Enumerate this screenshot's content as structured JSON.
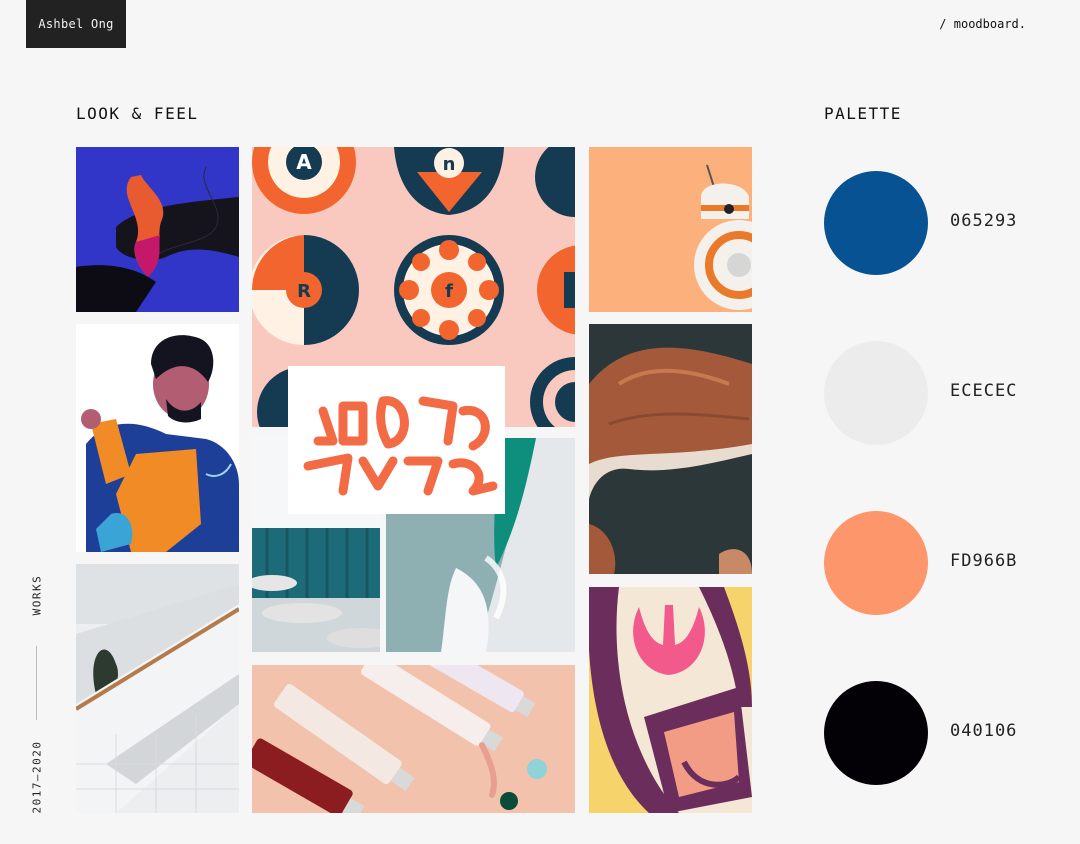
{
  "header": {
    "brand": "Ashbel Ong",
    "breadcrumb": "/ moodboard."
  },
  "sections": {
    "look_and_feel": "LOOK & FEEL",
    "palette": "PALETTE"
  },
  "sidebar": {
    "works_label": "WORKS",
    "years_label": "2017–2020"
  },
  "moodboard": {
    "tiles": [
      {
        "name": "hand-ribbon-image"
      },
      {
        "name": "character-portrait-image"
      },
      {
        "name": "staircase-image"
      },
      {
        "name": "letter-pattern-image",
        "letters": [
          "A",
          "n",
          "R",
          "f"
        ]
      },
      {
        "name": "logo-lettering-card"
      },
      {
        "name": "cafe-seating-image"
      },
      {
        "name": "ocean-aerial-image"
      },
      {
        "name": "paint-tubes-image"
      },
      {
        "name": "droid-image"
      },
      {
        "name": "canyon-aerial-image"
      },
      {
        "name": "rebel-emblem-image"
      }
    ]
  },
  "palette": {
    "swatches": [
      {
        "hex": "065293",
        "color": "#065293"
      },
      {
        "hex": "ECECEC",
        "color": "#ECECEC"
      },
      {
        "hex": "FD966B",
        "color": "#FD966B"
      },
      {
        "hex": "040106",
        "color": "#040106"
      }
    ]
  }
}
